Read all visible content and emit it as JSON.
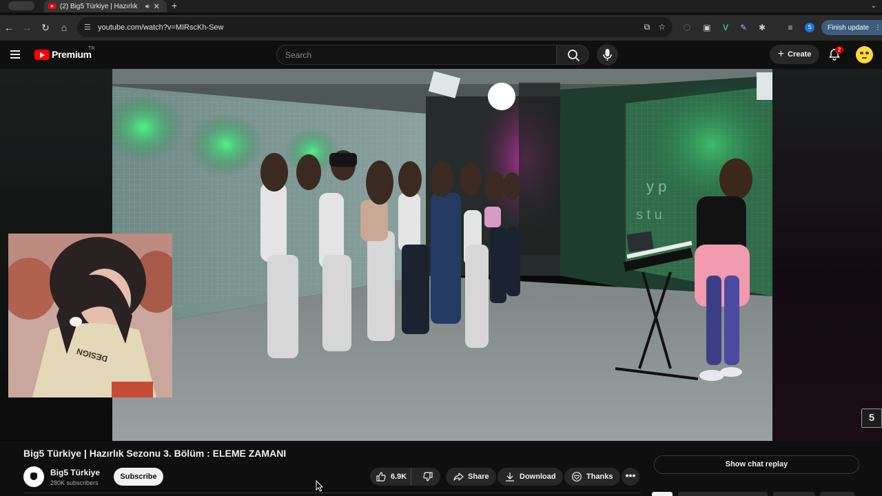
{
  "browser": {
    "tab_title": "(2) Big5 Türkiye | Hazırlık",
    "url": "youtube.com/watch?v=MIRscKh-Sew",
    "finish_update_label": "Finish update",
    "profile_initial": "S"
  },
  "header": {
    "logo_text": "Premium",
    "country_code": "TR",
    "search_placeholder": "Search",
    "create_label": "Create",
    "notification_count": "2"
  },
  "video": {
    "title": "Big5 Türkiye | Hazırlık Sezonu 3. Bölüm : ELEME ZAMANI",
    "watermark": "5",
    "studio_letters": "y p",
    "studio_letters_2": "s t u",
    "webcam_shirt_text": "DESIGN"
  },
  "channel": {
    "name": "Big5 Türkiye",
    "subscribers": "280K subscribers",
    "subscribe_label": "Subscribe"
  },
  "actions": {
    "like_count": "6.9K",
    "share_label": "Share",
    "download_label": "Download",
    "thanks_label": "Thanks",
    "more_label": "•••"
  },
  "chat": {
    "show_replay_label": "Show chat replay"
  },
  "colors": {
    "background": "#0f0f0f",
    "brand_red": "#ff0000",
    "pill": "#272727",
    "finish_update_bg": "#3e5c7e"
  }
}
